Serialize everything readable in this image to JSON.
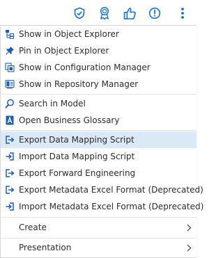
{
  "toolbar": {
    "icons": [
      "shield-check-icon",
      "award-ribbon-icon",
      "thumbs-up-icon",
      "exclamation-circle-icon",
      "vertical-dots-icon"
    ],
    "accent_color": "#1a6fc4"
  },
  "menu": {
    "group1": [
      {
        "label": "Show in Object Explorer",
        "icon": "object-explorer-icon"
      },
      {
        "label": "Pin in Object Explorer",
        "icon": "pin-icon"
      },
      {
        "label": "Show in Configuration Manager",
        "icon": "configuration-manager-icon"
      },
      {
        "label": "Show in Repository Manager",
        "icon": "repository-manager-icon"
      }
    ],
    "group2": [
      {
        "label": "Search in Model",
        "icon": "search-icon"
      },
      {
        "label": "Open Business Glossary",
        "icon": "glossary-icon"
      }
    ],
    "group3": [
      {
        "label": "Export Data Mapping Script",
        "icon": "export-icon",
        "active": true
      },
      {
        "label": "Import Data Mapping Script",
        "icon": "import-icon"
      },
      {
        "label": "Export Forward Engineering",
        "icon": "export-icon"
      },
      {
        "label": "Export Metadata Excel Format (Deprecated)",
        "icon": "export-icon"
      },
      {
        "label": "Import Metadata Excel Format (Deprecated)",
        "icon": "import-icon"
      }
    ],
    "submenus": [
      {
        "label": "Create"
      },
      {
        "label": "Presentation"
      }
    ],
    "highlight_color": "#dbe8f6"
  }
}
